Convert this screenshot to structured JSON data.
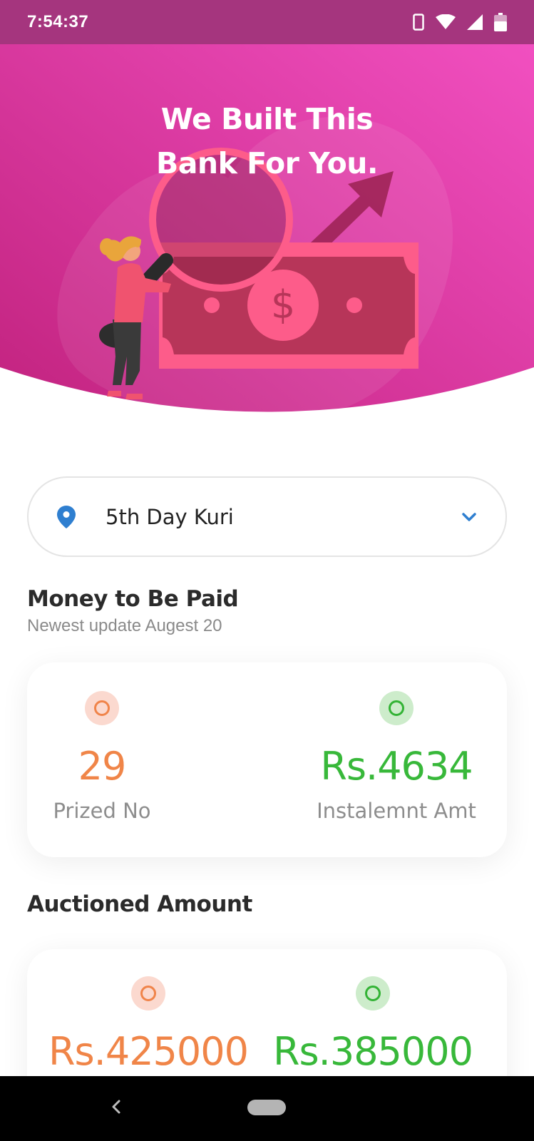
{
  "status_bar": {
    "time": "7:54:37",
    "icons": [
      "phone-icon",
      "wifi-icon",
      "signal-icon",
      "battery-icon"
    ]
  },
  "hero": {
    "title_line1": "We Built This",
    "title_line2": "Bank For You.",
    "gradient_start": "#c2237f",
    "gradient_end": "#f452c4"
  },
  "branch_select": {
    "selected": "5th Day Kuri",
    "icon": "location-pin-icon"
  },
  "money_to_be_paid": {
    "title": "Money to Be Paid",
    "subtitle": "Newest update Augest 20",
    "prized_no": {
      "value": "29",
      "label": "Prized No"
    },
    "instalment": {
      "value": "Rs.4634",
      "label": "Instalemnt Amt"
    }
  },
  "auctioned_amount": {
    "title": "Auctioned Amount",
    "first": {
      "value": "Rs.425000"
    },
    "second": {
      "value": "Rs.385000"
    }
  },
  "colors": {
    "accent_orange": "#f08548",
    "accent_green": "#38b83a",
    "status_bar": "#a5357e",
    "pin_blue": "#2f7fd0"
  }
}
